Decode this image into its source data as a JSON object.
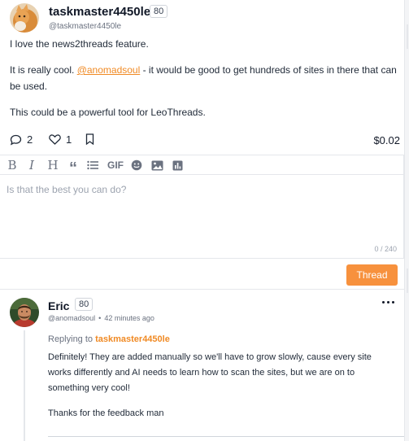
{
  "post": {
    "author": "taskmaster4450le",
    "reputation": "80",
    "handle": "@taskmaster4450le",
    "avatar": "cat-avatar",
    "paragraphs": {
      "p1": "I love the news2threads feature.",
      "p2_before": "It is really cool. ",
      "p2_mention": "@anomadsoul",
      "p2_after": " - it would be good to get hundreds of sites in there that can be used.",
      "p3": "This could be a powerful tool for LeoThreads."
    },
    "comments_count": "2",
    "likes_count": "1",
    "payout": "$0.02",
    "icons": [
      "comment-icon",
      "heart-icon",
      "bookmark-icon"
    ]
  },
  "editor": {
    "toolbar": {
      "bold": "B",
      "italic": "I",
      "heading": "H",
      "quote": "“",
      "gif": "GIF",
      "icons": [
        "bold-icon",
        "italic-icon",
        "heading-icon",
        "quote-icon",
        "list-icon",
        "gif-button",
        "emoji-icon",
        "image-icon",
        "poll-icon"
      ]
    },
    "placeholder": "Is that the best you can do?",
    "counter": "0 / 240",
    "submit_label": "Thread"
  },
  "reply": {
    "author": "Eric",
    "reputation": "80",
    "handle": "@anomadsoul",
    "time": "42 minutes ago",
    "replying_prefix": "Replying to ",
    "replying_target": "taskmaster4450le",
    "paragraphs": {
      "p1": "Definitely! They are added manually so we'll have to grow slowly, cause every site works differently and AI needs to learn how to scan the sites, but we are on to something very cool!",
      "p2": "Thanks for the feedback man"
    }
  },
  "colors": {
    "accent": "#f7913d",
    "mention": "#f08a24",
    "border": "#e5e7eb",
    "muted": "#6b7280"
  }
}
